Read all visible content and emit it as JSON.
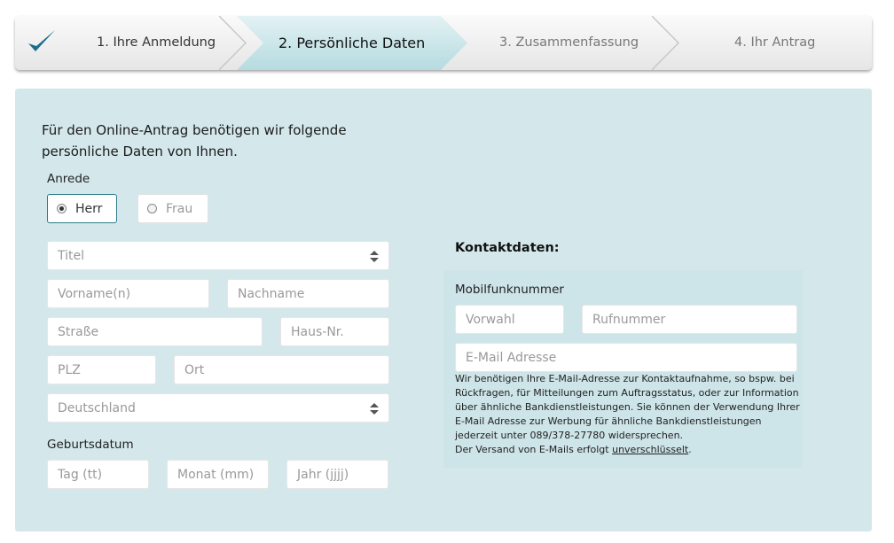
{
  "stepper": {
    "steps": [
      {
        "label": "1. Ihre Anmeldung",
        "state": "done"
      },
      {
        "label": "2. Persönliche Daten",
        "state": "active"
      },
      {
        "label": "3. Zusammenfassung",
        "state": "upcoming"
      },
      {
        "label": "4. Ihr Antrag",
        "state": "upcoming"
      }
    ],
    "check_icon": "checkmark-icon",
    "accent_color": "#1b6f8a"
  },
  "form": {
    "intro": "Für den Online-Antrag benötigen wir folgende persönliche Daten von Ihnen.",
    "salutation": {
      "label": "Anrede",
      "options": [
        "Herr",
        "Frau"
      ],
      "selected": "Herr"
    },
    "title_select": {
      "placeholder": "Titel"
    },
    "first_name": {
      "placeholder": "Vorname(n)"
    },
    "last_name": {
      "placeholder": "Nachname"
    },
    "street": {
      "placeholder": "Straße"
    },
    "house_number": {
      "placeholder": "Haus-Nr."
    },
    "zip": {
      "placeholder": "PLZ"
    },
    "city": {
      "placeholder": "Ort"
    },
    "country_select": {
      "value": "Deutschland"
    },
    "birthdate": {
      "label": "Geburtsdatum",
      "day": "Tag (tt)",
      "month": "Monat (mm)",
      "year": "Jahr (jjjj)"
    }
  },
  "contact": {
    "heading": "Kontaktdaten:",
    "mobile_label": "Mobilfunknummer",
    "area_code": "Vorwahl",
    "phone_number": "Rufnummer",
    "email": "E-Mail Adresse",
    "note": "Wir benötigen Ihre E-Mail-Adresse zur Kontaktaufnahme, so bspw. bei Rückfragen, für Mitteilungen zum Auftragsstatus, oder zur Information über ähnliche Bankdienstleistungen. Sie können der Verwendung Ihrer E-Mail Adresse zur Werbung für ähnliche Bankdienstleistungen jederzeit unter 089/378-27780 widersprechen.",
    "note_line2_prefix": "Der Versand von E-Mails erfolgt ",
    "note_link": "unverschlüsselt",
    "note_line2_suffix": "."
  },
  "colors": {
    "panel_background": "#d4e8ec",
    "active_step_background": "#bfe0e5",
    "selected_radio_border": "#2b7a8c"
  }
}
